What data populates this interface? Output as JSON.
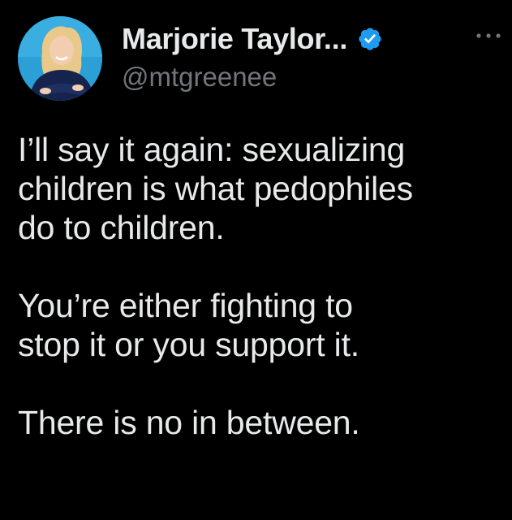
{
  "author": {
    "display_name": "Marjorie Taylor...",
    "handle": "@mtgreenee",
    "verified": true,
    "avatar_icon": "profile-photo",
    "verified_icon": "verified-badge-icon"
  },
  "menu": {
    "icon": "more-options-icon"
  },
  "tweet": {
    "paragraphs": [
      "I’ll say it again: sexualizing\nchildren is what pedophiles\ndo to children.",
      "You’re either fighting to\nstop it or you support it.",
      "There is no in between."
    ]
  },
  "colors": {
    "background": "#000000",
    "text": "#e7e9ea",
    "secondary_text": "#71767b",
    "verified": "#1d9bf0"
  }
}
